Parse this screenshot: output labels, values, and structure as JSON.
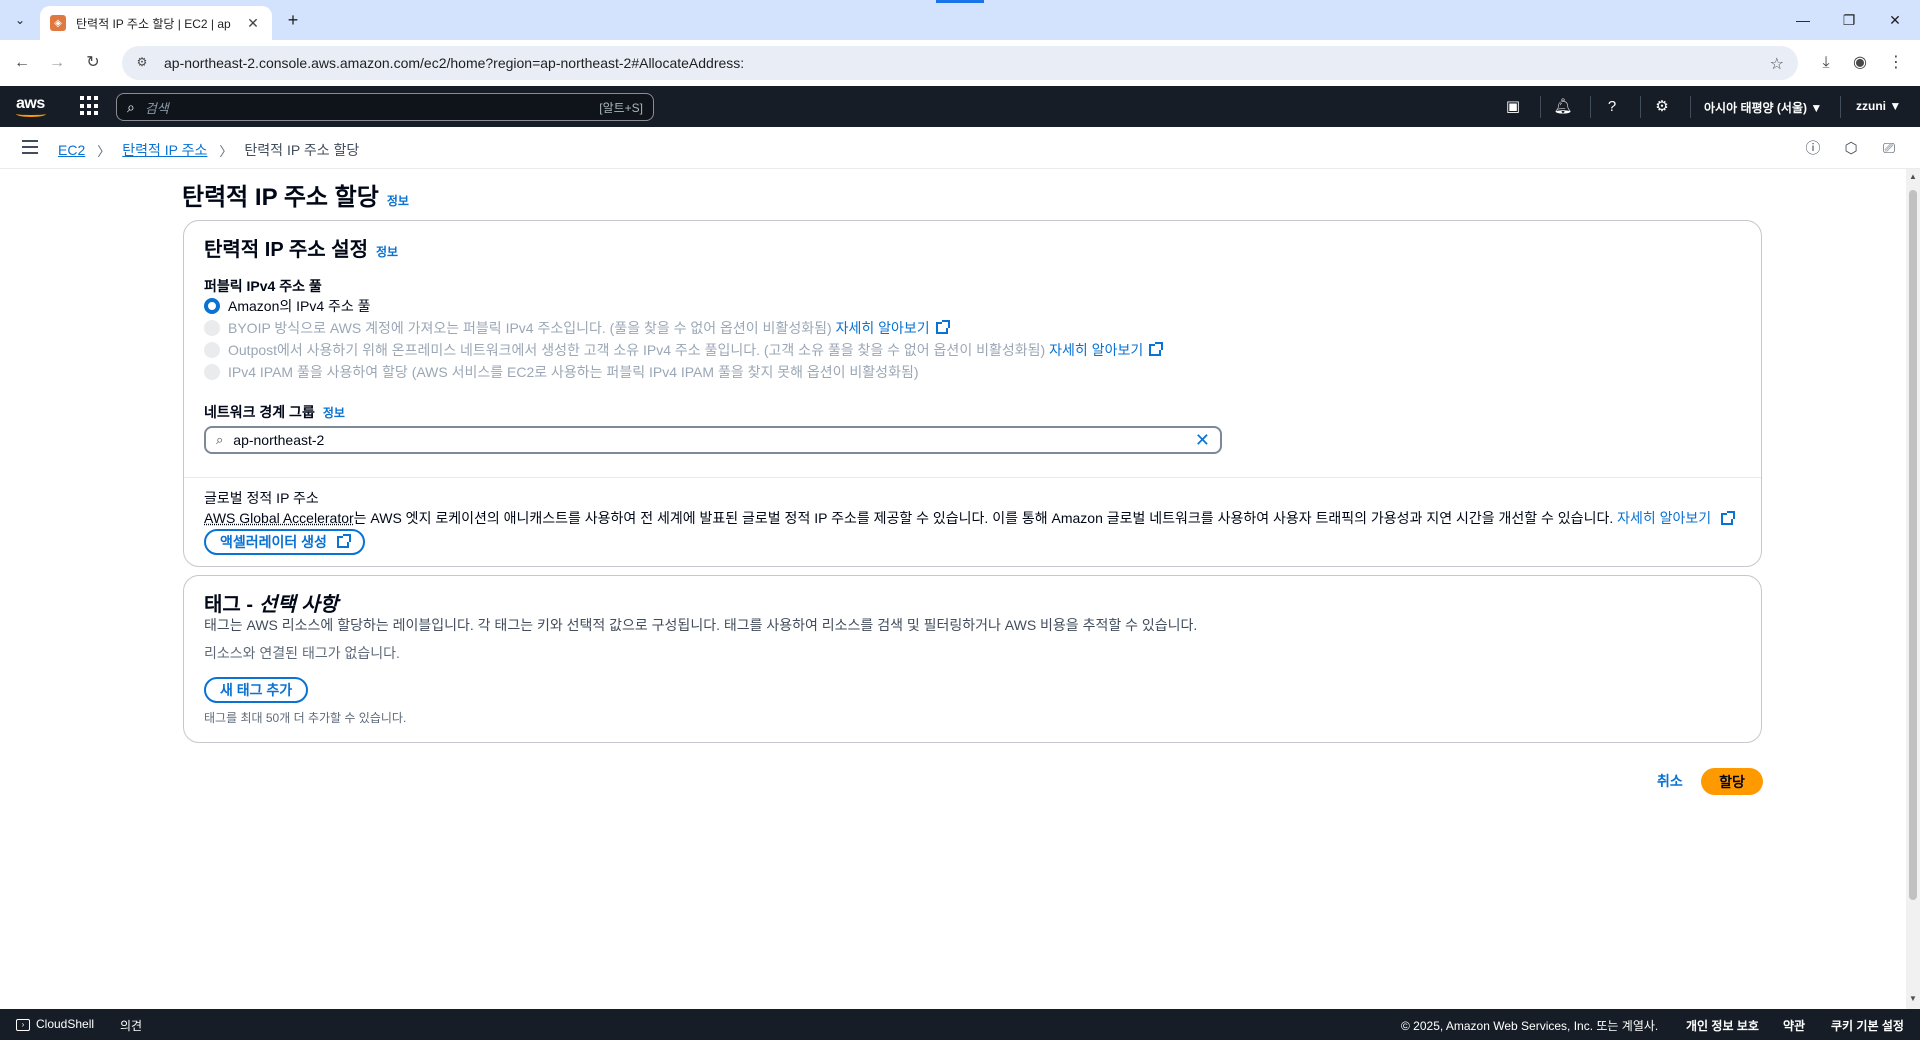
{
  "browser": {
    "tab_title": "탄력적 IP 주소 할당 | EC2 | ap",
    "url": "ap-northeast-2.console.aws.amazon.com/ec2/home?region=ap-northeast-2#AllocateAddress:"
  },
  "awsnav": {
    "logo": "aws",
    "search_placeholder": "검색",
    "search_shortcut": "[알트+S]",
    "region": "아시아 태평양 (서울) ▼",
    "user": "zzuni ▼"
  },
  "breadcrumb": {
    "items": [
      "EC2",
      "탄력적 IP 주소"
    ],
    "current": "탄력적 IP 주소 할당"
  },
  "page": {
    "title": "탄력적 IP 주소 할당",
    "info": "정보"
  },
  "settings": {
    "title": "탄력적 IP 주소 설정",
    "info": "정보",
    "pool_label": "퍼블릭 IPv4 주소 풀",
    "options": [
      {
        "label": "Amazon의 IPv4 주소 풀",
        "link": "",
        "selected": true,
        "disabled": false
      },
      {
        "label": "BYOIP 방식으로 AWS 계정에 가져오는 퍼블릭 IPv4 주소입니다. (풀을 찾을 수 없어 옵션이 비활성화됨)",
        "link": "자세히 알아보기",
        "selected": false,
        "disabled": true
      },
      {
        "label": "Outpost에서 사용하기 위해 온프레미스 네트워크에서 생성한 고객 소유 IPv4 주소 풀입니다. (고객 소유 풀을 찾을 수 없어 옵션이 비활성화됨)",
        "link": "자세히 알아보기",
        "selected": false,
        "disabled": true
      },
      {
        "label": "IPv4 IPAM 풀을 사용하여 할당 (AWS 서비스를 EC2로 사용하는 퍼블릭 IPv4 IPAM 풀을 찾지 못해 옵션이 비활성화됨)",
        "link": "",
        "selected": false,
        "disabled": true
      }
    ],
    "network_border_label": "네트워크 경계 그룹",
    "network_border_info": "정보",
    "network_border_value": "ap-northeast-2",
    "global_title": "글로벌 정적 IP 주소",
    "global_desc_underlined": "AWS Global Accelerator",
    "global_desc": "는 AWS 엣지 로케이션의 애니캐스트를 사용하여 전 세계에 발표된 글로벌 정적 IP 주소를 제공할 수 있습니다. 이를 통해 Amazon 글로벌 네트워크를 사용하여 사용자 트래픽의 가용성과 지연 시간을 개선할 수 있습니다.",
    "global_link": "자세히 알아보기",
    "accelerator_button": "액셀러레이터 생성"
  },
  "tags": {
    "title": "태그 - ",
    "title_italic": "선택 사항",
    "description": "태그는 AWS 리소스에 할당하는 레이블입니다. 각 태그는 키와 선택적 값으로 구성됩니다. 태그를 사용하여 리소스를 검색 및 필터링하거나 AWS 비용을 추적할 수 있습니다.",
    "empty": "리소스와 연결된 태그가 없습니다.",
    "add_button": "새 태그 추가",
    "limit_note": "태그를 최대 50개 더 추가할 수 있습니다."
  },
  "actions": {
    "cancel": "취소",
    "allocate": "할당"
  },
  "footer": {
    "cloudshell": "CloudShell",
    "feedback": "의견",
    "copyright": "© 2025, Amazon Web Services, Inc. 또는 계열사.",
    "privacy": "개인 정보 보호",
    "terms": "약관",
    "cookies": "쿠키 기본 설정"
  },
  "colors": {
    "link": "#0972d3",
    "primary": "#ff9900",
    "nav_bg": "#161d26"
  }
}
